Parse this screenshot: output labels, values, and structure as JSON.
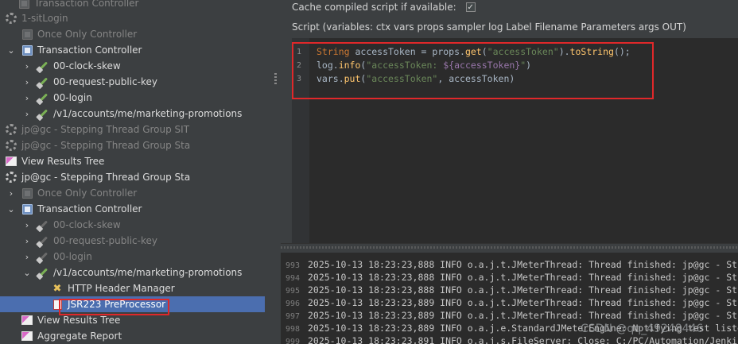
{
  "tree": {
    "items": [
      {
        "label": "Transaction Controller"
      },
      {
        "label": "1-sitLogin"
      },
      {
        "label": "Once Only Controller"
      },
      {
        "label": "Transaction Controller"
      },
      {
        "label": "00-clock-skew"
      },
      {
        "label": "00-request-public-key"
      },
      {
        "label": "00-login"
      },
      {
        "label": "/v1/accounts/me/marketing-promotions"
      },
      {
        "label": "jp@gc - Stepping Thread Group SIT"
      },
      {
        "label": "jp@gc - Stepping Thread Group Sta"
      },
      {
        "label": "View Results Tree"
      },
      {
        "label": "jp@gc - Stepping Thread Group Sta"
      },
      {
        "label": "Once Only Controller"
      },
      {
        "label": "Transaction Controller"
      },
      {
        "label": "00-clock-skew"
      },
      {
        "label": "00-request-public-key"
      },
      {
        "label": "00-login"
      },
      {
        "label": "/v1/accounts/me/marketing-promotions"
      },
      {
        "label": "HTTP Header Manager"
      },
      {
        "label": "JSR223 PreProcessor"
      },
      {
        "label": "View Results Tree"
      },
      {
        "label": "Aggregate Report"
      }
    ]
  },
  "cache": {
    "label": "Cache compiled script if available:",
    "checked": "✓"
  },
  "script": {
    "label": "Script (variables: ctx vars props sampler log Label Filename Parameters args OUT)",
    "line_numbers": [
      "1",
      "2",
      "3"
    ],
    "lines": [
      {
        "p1": "String",
        "p2": " accessToken = props.",
        "p3": "get",
        "p4": "(",
        "p5": "\"accessToken\"",
        "p6": ").",
        "p7": "toString",
        "p8": "();"
      },
      {
        "p1": "log.",
        "p2": "info",
        "p3": "(",
        "p4": "\"accessToken: ",
        "p5": "${accessToken}",
        "p6": "\"",
        "p7": ")"
      },
      {
        "p1": "vars.",
        "p2": "put",
        "p3": "(",
        "p4": "\"accessToken\"",
        "p5": ", accessToken)"
      }
    ]
  },
  "log": {
    "rows": [
      {
        "n": "993",
        "text": "2025-10-13 18:23:23,888 INFO o.a.j.t.JMeterThread: Thread finished: jp@gc - St"
      },
      {
        "n": "994",
        "text": "2025-10-13 18:23:23,888 INFO o.a.j.t.JMeterThread: Thread finished: jp@gc - St"
      },
      {
        "n": "995",
        "text": "2025-10-13 18:23:23,888 INFO o.a.j.t.JMeterThread: Thread finished: jp@gc - St"
      },
      {
        "n": "996",
        "text": "2025-10-13 18:23:23,889 INFO o.a.j.t.JMeterThread: Thread finished: jp@gc - St"
      },
      {
        "n": "997",
        "text": "2025-10-13 18:23:23,889 INFO o.a.j.t.JMeterThread: Thread finished: jp@gc - St"
      },
      {
        "n": "998",
        "text": "2025-10-13 18:23:23,889 INFO o.a.j.e.StandardJMeterEngine: Notifying test liste"
      },
      {
        "n": "999",
        "text": "2025-10-13 18:23:23,891 INFO o.a.j.s.FileServer: Close: C:/PC/Automation/Jenkin"
      }
    ]
  },
  "watermark": "CSDN @qq_49248446",
  "colors": {
    "selection": "#4b6eaf",
    "highlight_box": "#e0282a",
    "editor_bg": "#2b2b2b"
  }
}
